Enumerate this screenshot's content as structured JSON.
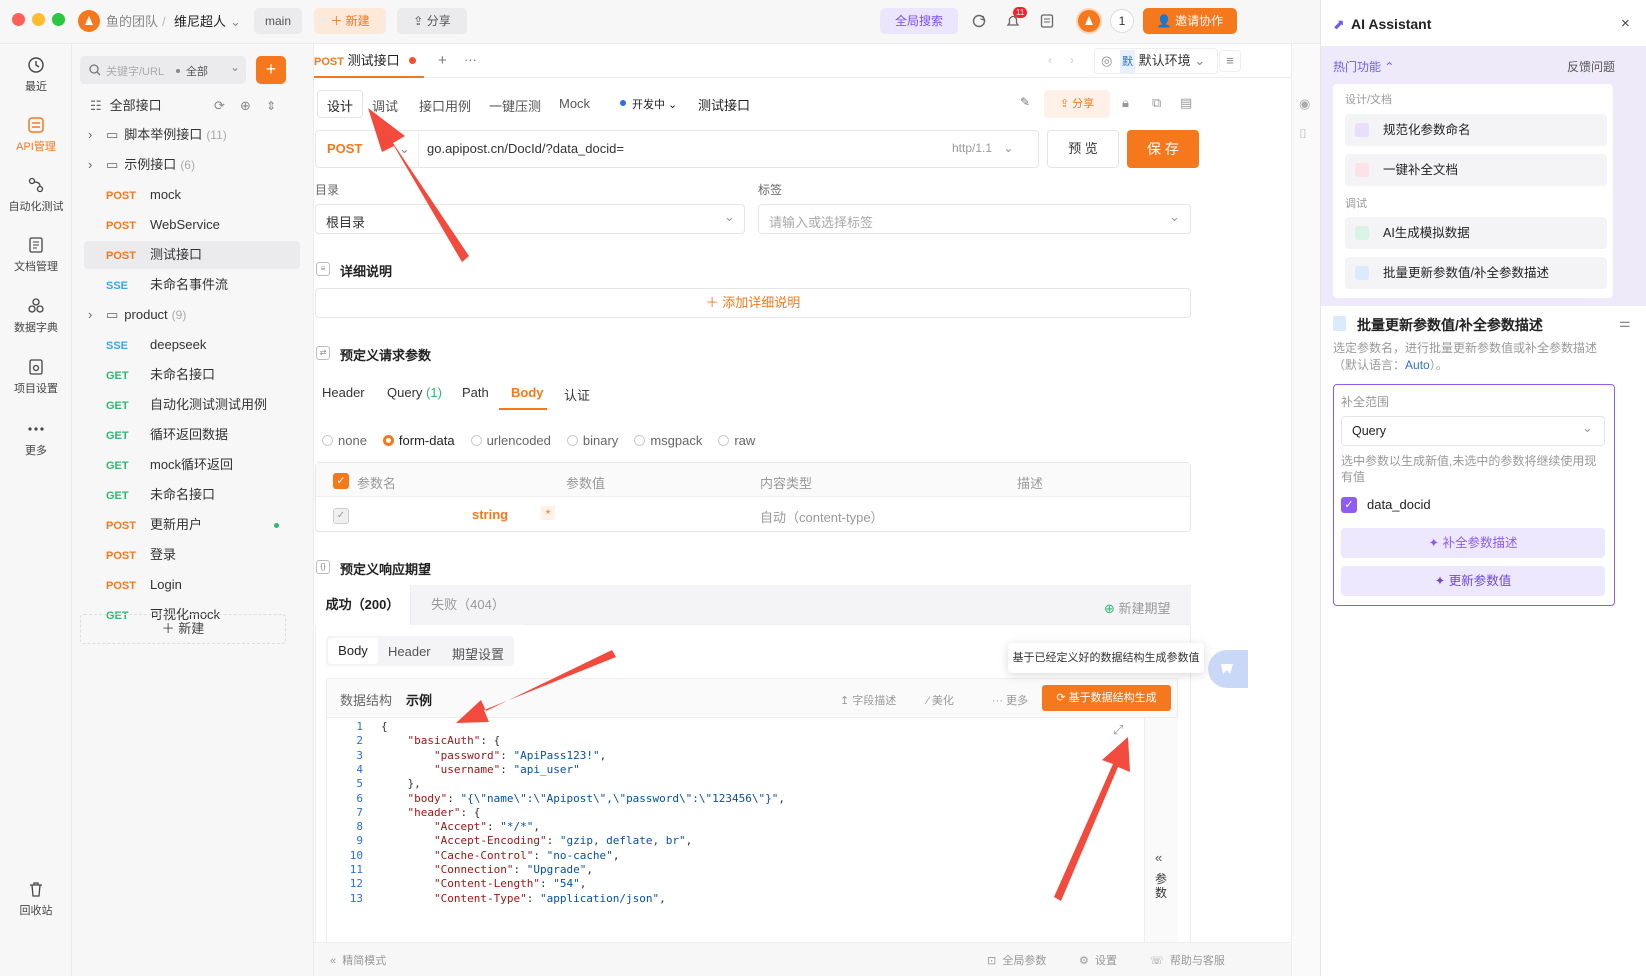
{
  "window": {
    "team": "鱼的团队",
    "project": "维尼超人",
    "branch": "main",
    "new_label": "新建",
    "share_label": "分享",
    "global_search": "全局搜索",
    "notif_count": "11",
    "user_count": "1",
    "invite_label": "邀请协作"
  },
  "leftnav": [
    {
      "label": "最近"
    },
    {
      "label": "API管理"
    },
    {
      "label": "自动化测试"
    },
    {
      "label": "文档管理"
    },
    {
      "label": "数据字典"
    },
    {
      "label": "项目设置"
    },
    {
      "label": "更多"
    },
    {
      "label": "回收站"
    }
  ],
  "tree": {
    "search_placeholder": "关键字/URL",
    "filter": "全部",
    "root": "全部接口",
    "new_label": "新建",
    "items": [
      {
        "type": "folder",
        "name": "脚本举例接口",
        "count": "(11)"
      },
      {
        "type": "folder",
        "name": "示例接口",
        "count": "(6)"
      },
      {
        "method": "POST",
        "name": "mock"
      },
      {
        "method": "POST",
        "name": "WebService"
      },
      {
        "method": "POST",
        "name": "测试接口"
      },
      {
        "method": "SSE",
        "name": "未命名事件流"
      },
      {
        "type": "folder",
        "name": "product",
        "count": "(9)"
      },
      {
        "method": "SSE",
        "name": "deepseek"
      },
      {
        "method": "GET",
        "name": "未命名接口"
      },
      {
        "method": "GET",
        "name": "自动化测试测试用例"
      },
      {
        "method": "GET",
        "name": "循环返回数据"
      },
      {
        "method": "GET",
        "name": "mock循环返回"
      },
      {
        "method": "GET",
        "name": "未命名接口"
      },
      {
        "method": "POST",
        "name": "更新用户"
      },
      {
        "method": "POST",
        "name": "登录"
      },
      {
        "method": "POST",
        "name": "Login"
      },
      {
        "method": "GET",
        "name": "可视化mock"
      }
    ]
  },
  "doc_tab": {
    "method": "POST",
    "name": "测试接口"
  },
  "env": {
    "badge": "默",
    "name": "默认环境"
  },
  "subtabs": [
    "设计",
    "调试",
    "接口用例",
    "一键压测",
    "Mock"
  ],
  "status": "开发中",
  "api_name": "测试接口",
  "share2": "分享",
  "url": {
    "method": "POST",
    "value": "go.apipost.cn/DocId/?data_docid=",
    "protocol": "http/1.1",
    "preview": "预 览",
    "save": "保 存"
  },
  "dir": {
    "label": "目录",
    "value": "根目录"
  },
  "tags": {
    "label": "标签",
    "placeholder": "请输入或选择标签"
  },
  "detail": {
    "title": "详细说明",
    "add": "添加详细说明"
  },
  "params": {
    "title": "预定义请求参数",
    "tabs": [
      "Header",
      "Query",
      "Path",
      "Body",
      "认证"
    ],
    "query_count": "(1)",
    "body_types": [
      "none",
      "form-data",
      "urlencoded",
      "binary",
      "msgpack",
      "raw"
    ],
    "cols": [
      "参数名",
      "参数值",
      "内容类型",
      "描述"
    ],
    "row_type": "string",
    "row_required": "*",
    "row_content": "自动（content-type）"
  },
  "resp": {
    "title": "预定义响应期望",
    "ok": "成功（200）",
    "fail": "失败（404）",
    "new": "新建期望",
    "subtabs": [
      "Body",
      "Header",
      "期望设置"
    ],
    "views": [
      "数据结构",
      "示例"
    ],
    "field_desc": "字段描述",
    "beautify": "美化",
    "more": "更多",
    "gen": "基于数据结构生成",
    "tooltip": "基于已经定义好的数据结构生成参数值",
    "side_label": "参数"
  },
  "code": [
    "{",
    "    \"basicAuth\": {",
    "        \"password\": \"ApiPass123!\",",
    "        \"username\": \"api_user\"",
    "    },",
    "    \"body\": \"{\\\"name\\\":\\\"Apipost\\\",\\\"password\\\":\\\"123456\\\"}\",",
    "    \"header\": {",
    "        \"Accept\": \"*/*\",",
    "        \"Accept-Encoding\": \"gzip, deflate, br\",",
    "        \"Cache-Control\": \"no-cache\",",
    "        \"Connection\": \"Upgrade\",",
    "        \"Content-Length\": \"54\",",
    "        \"Content-Type\": \"application/json\","
  ],
  "footer": {
    "simple": "精简模式",
    "global": "全局参数",
    "settings": "设置",
    "help": "帮助与客服"
  },
  "ai": {
    "title": "AI Assistant",
    "hot": "热门功能",
    "feedback": "反馈问题",
    "group1": "设计/文档",
    "group2": "调试",
    "items": [
      "规范化参数命名",
      "一键补全文档",
      "AI生成模拟数据",
      "批量更新参数值/补全参数描述"
    ],
    "panel_title": "批量更新参数值/补全参数描述",
    "desc_pre": "选定参数名，进行批量更新参数值或补全参数描述（默认语言：",
    "desc_lang": "Auto",
    "desc_post": "）。",
    "scope_label": "补全范围",
    "scope_value": "Query",
    "hint": "选中参数以生成新值,未选中的参数将继续使用现有值",
    "param": "data_docid",
    "btn1": "补全参数描述",
    "btn2": "更新参数值"
  },
  "colors": {
    "accent": "#f5781c",
    "ai": "#8e5cf0"
  }
}
